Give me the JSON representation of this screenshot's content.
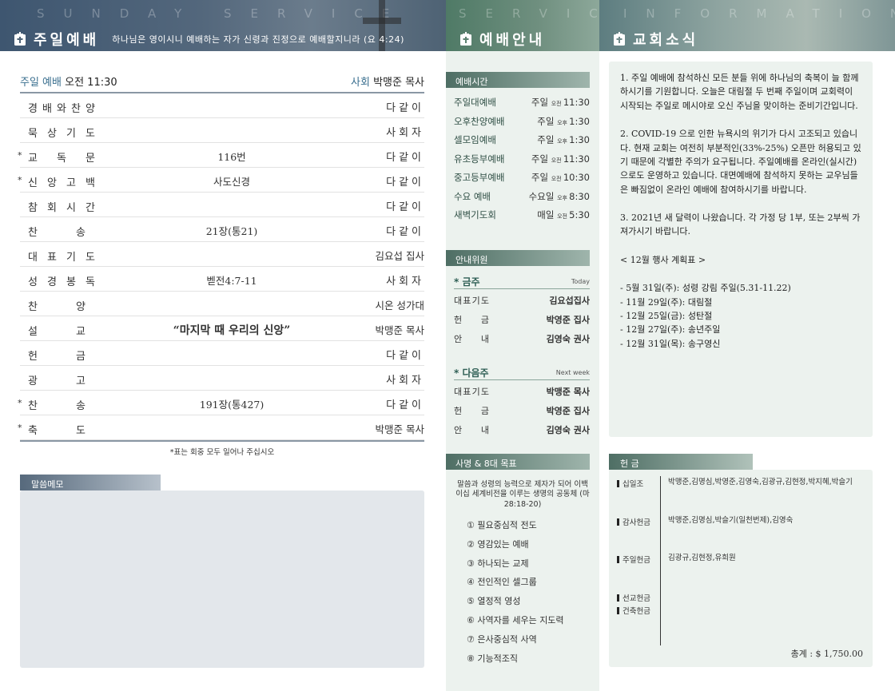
{
  "banners": {
    "left_ghost": "SUNDAY SERVICE",
    "left_title": "주일예배",
    "left_sub": "하나님은 영이시니 예배하는 자가 신령과 진정으로 예배할지니라 (요 4:24)",
    "mid_ghost": "SERVICE",
    "mid_title": "예배안내",
    "right_ghost": "INFORMATION",
    "right_title": "교회소식"
  },
  "service": {
    "label": "주일 예배",
    "time": "오전 11:30",
    "host_label": "사회",
    "host": "박맹준 목사"
  },
  "order": [
    {
      "star": "",
      "label": [
        "경",
        "배",
        "와",
        "찬",
        "양"
      ],
      "mid": "",
      "right": "다같이",
      "tight": false
    },
    {
      "star": "",
      "label": [
        "묵",
        "상",
        "기",
        "도"
      ],
      "mid": "",
      "right": "사회자",
      "tight": false
    },
    {
      "star": "*",
      "label": [
        "교",
        "독",
        "문"
      ],
      "mid": "116번",
      "right": "다같이",
      "tight": false
    },
    {
      "star": "*",
      "label": [
        "신",
        "앙",
        "고",
        "백"
      ],
      "mid": "사도신경",
      "right": "다같이",
      "tight": false
    },
    {
      "star": "",
      "label": [
        "참",
        "회",
        "시",
        "간"
      ],
      "mid": "",
      "right": "다같이",
      "tight": false
    },
    {
      "star": "",
      "label": [
        "찬",
        "송"
      ],
      "mid": "21장(통21)",
      "right": "다같이",
      "tight": false
    },
    {
      "star": "",
      "label": [
        "대",
        "표",
        "기",
        "도"
      ],
      "mid": "",
      "right": "김요섭 집사",
      "tight": true
    },
    {
      "star": "",
      "label": [
        "성",
        "경",
        "봉",
        "독"
      ],
      "mid": "벧전4:7-11",
      "right": "사회자",
      "tight": false
    },
    {
      "star": "",
      "label": [
        "찬",
        "양"
      ],
      "mid": "",
      "right": "시온 성가대",
      "tight": true
    },
    {
      "star": "",
      "label": [
        "설",
        "교"
      ],
      "mid": "“마지막 때 우리의 신앙”",
      "right": "박맹준 목사",
      "tight": true,
      "big": true
    },
    {
      "star": "",
      "label": [
        "헌",
        "금"
      ],
      "mid": "",
      "right": "다같이",
      "tight": false
    },
    {
      "star": "",
      "label": [
        "광",
        "고"
      ],
      "mid": "",
      "right": "사회자",
      "tight": false
    },
    {
      "star": "*",
      "label": [
        "찬",
        "송"
      ],
      "mid": "191장(통427)",
      "right": "다같이",
      "tight": false
    },
    {
      "star": "*",
      "label": [
        "축",
        "도"
      ],
      "mid": "",
      "right": "박맹준 목사",
      "tight": true
    }
  ],
  "note": "*표는 회중 모두 일어나 주십시오",
  "memo_label": "말씀메모",
  "worship_times": {
    "tab": "예배시간",
    "items": [
      {
        "name": "주일대예배",
        "day": "주일",
        "ampm": "오전",
        "time": "11:30"
      },
      {
        "name": "오후찬양예배",
        "day": "주일",
        "ampm": "오후",
        "time": "1:30"
      },
      {
        "name": "셀모임예배",
        "day": "주일",
        "ampm": "오후",
        "time": "1:30"
      },
      {
        "name": "유초등부예배",
        "day": "주일",
        "ampm": "오전",
        "time": "11:30"
      },
      {
        "name": "중고등부예배",
        "day": "주일",
        "ampm": "오전",
        "time": "10:30"
      },
      {
        "name": "수요 예배",
        "day": "수요일",
        "ampm": "오후",
        "time": "8:30"
      },
      {
        "name": "새벽기도회",
        "day": "매일",
        "ampm": "오전",
        "time": "5:30"
      }
    ]
  },
  "guide": {
    "tab": "안내위원",
    "this_week": {
      "title": "* 금주",
      "en": "Today",
      "rows": [
        {
          "role": [
            "대",
            "표",
            "기",
            "도"
          ],
          "name": "김요섭집사"
        },
        {
          "role": [
            "헌",
            "금"
          ],
          "name": "박영준 집사"
        },
        {
          "role": [
            "안",
            "내"
          ],
          "name": "김영숙 권사"
        }
      ]
    },
    "next_week": {
      "title": "* 다음주",
      "en": "Next week",
      "rows": [
        {
          "role": [
            "대",
            "표",
            "기",
            "도"
          ],
          "name": "박맹준 목사"
        },
        {
          "role": [
            "헌",
            "금"
          ],
          "name": "박영준 집사"
        },
        {
          "role": [
            "안",
            "내"
          ],
          "name": "김영숙 권사"
        }
      ]
    }
  },
  "mission": {
    "tab": "사명 & 8대 목표",
    "vision": "말씀과 성령의 능력으로 제자가 되어 이백 이십 세계비전을 이루는 생명의 공동체 (마 28:18-20)",
    "goals": [
      "① 필요중심적 전도",
      "② 영감있는 예배",
      "③ 하나되는 교제",
      "④ 전인적인 셀그룹",
      "⑤ 열정적 영성",
      "⑥ 사역자를 세우는 지도력",
      "⑦ 은사중심적 사역",
      "⑧ 기능적조직"
    ]
  },
  "news": {
    "items": [
      "1. 주일 예배에 참석하신 모든 분들 위에 하나님의 축복이 늘 함께 하시기를 기원합니다. 오늘은 대림절 두 번째 주일이며 교회력이 시작되는 주일로 메시야로 오신 주님을 맞이하는 준비기간입니다.",
      "2. COVID-19 으로 인한 뉴욕시의 위기가 다시 고조되고 있습니다.  현재 교회는 여전히 부분적인(33%-25%) 오픈만 허용되고 있기 때문에 각별한 주의가 요구됩니다. 주일예배를 온라인(실시간)으로도 운영하고 있습니다. 대면예배에 참석하지 못하는 교우님들은 빠짐없이 온라인 예배에 참여하시기를 바랍니다.",
      "3. 2021년 새 달력이 나왔습니다. 각 가정 당 1부, 또는 2부씩 가져가시기 바랍니다."
    ],
    "plan_title": "< 12월 행사 계획표 >",
    "plan": [
      "- 5월 31일(주): 성령 강림 주일(5.31-11.22)",
      "- 11월 29일(주): 대림절",
      "- 12월 25일(금): 성탄절",
      "- 12월 27일(주): 송년주일",
      "- 12월 31일(목): 송구영신"
    ]
  },
  "offering": {
    "tab": "헌 금",
    "categories": [
      {
        "name": "십일조",
        "names": "박맹준,김명심,박영준,김영숙,김광규,김현정,박지혜,박슬기"
      },
      {
        "name": "감사헌금",
        "names": "박맹준,김명심,박슬기(일천번제),김영숙"
      },
      {
        "name": "주일헌금",
        "names": "김광규,김현정,유희원"
      },
      {
        "name": "선교헌금",
        "names": ""
      },
      {
        "name": "건축헌금",
        "names": ""
      }
    ],
    "total": "총계 : $ 1,750.00"
  }
}
